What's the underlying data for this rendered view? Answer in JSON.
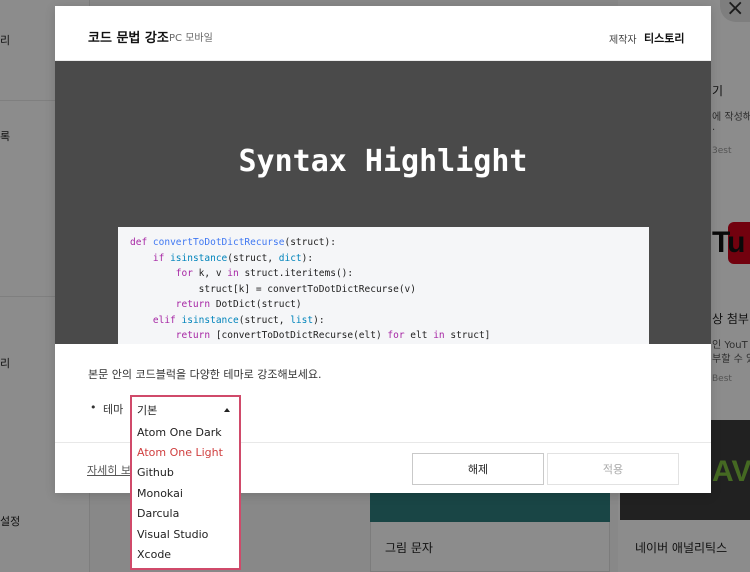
{
  "background": {
    "left_items": [
      "리",
      "록",
      "리",
      "설정"
    ],
    "right_cards": [
      {
        "title": "기",
        "line1": "에 작성해",
        "line2": ".",
        "badge": "3est"
      },
      {
        "title": "상 첨부",
        "line1": "인 YouT",
        "line2": "부할 수 있",
        "badge": "Best"
      }
    ],
    "yt_text": "Tu",
    "av_text": "AV",
    "mid_card_title": "그림 문자",
    "right_card_title": "네이버 애널리틱스",
    "close_glyph": "×"
  },
  "modal": {
    "title": "코드 문법 강조",
    "subtitle": "PC 모바일",
    "maker_label": "제작자",
    "maker_name": "티스토리",
    "preview_title": "Syntax Highlight",
    "description": "본문 안의 코드블럭을 다양한 테마로 강조해보세요.",
    "bullet": "•",
    "theme_label": "테마",
    "detail_link": "자세히 보",
    "release_button": "해제",
    "apply_button": "적용"
  },
  "code_lines": [
    "def convertToDotDictRecurse(struct):",
    "    if isinstance(struct, dict):",
    "        for k, v in struct.iteritems():",
    "            struct[k] = convertToDotDictRecurse(v)",
    "        return DotDict(struct)",
    "    elif isinstance(struct, list):",
    "        return [convertToDotDictRecurse(elt) for elt in struct]"
  ],
  "theme_dropdown": {
    "selected": "기본",
    "options": [
      "Atom One Dark",
      "Atom One Light",
      "Github",
      "Monokai",
      "Darcula",
      "Visual Studio",
      "Xcode"
    ],
    "highlighted": "Atom One Light"
  },
  "colors": {
    "dropdown_border": "#d04a6a",
    "highlight_text": "#d04040",
    "preview_bg": "#4a4a4a"
  }
}
